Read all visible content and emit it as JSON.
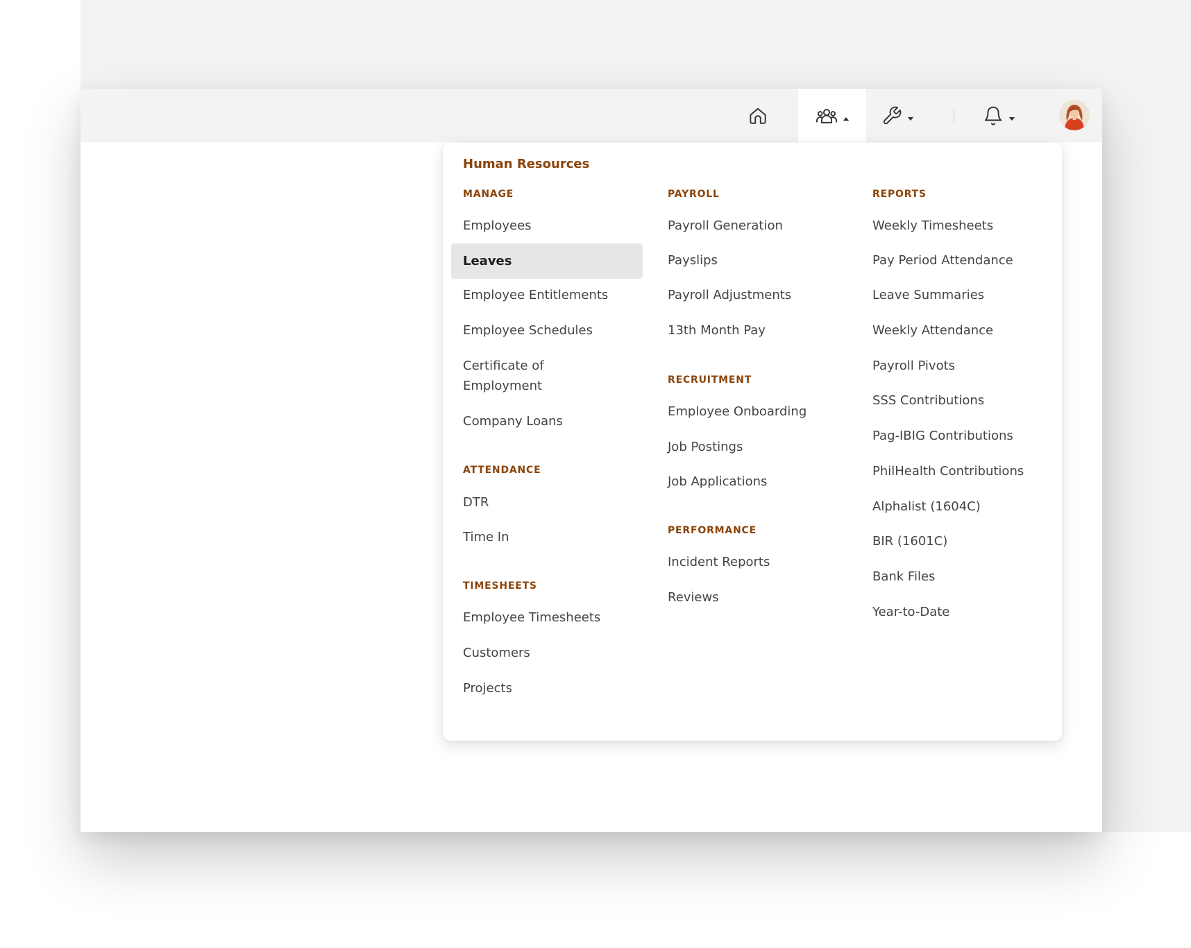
{
  "nav": {
    "icons": [
      "home-icon",
      "people-icon",
      "wrench-icon",
      "bell-icon"
    ],
    "avatar_icon": "user-avatar"
  },
  "menu": {
    "title": "Human Resources",
    "selected": "Leaves",
    "columns": [
      {
        "sections": [
          {
            "heading": "MANAGE",
            "items": [
              "Employees",
              "Leaves",
              "Employee Entitlements",
              "Employee Schedules",
              "Certificate of Employment",
              "Company Loans"
            ]
          },
          {
            "heading": "ATTENDANCE",
            "items": [
              "DTR",
              "Time In"
            ]
          },
          {
            "heading": "TIMESHEETS",
            "items": [
              "Employee Timesheets",
              "Customers",
              "Projects"
            ]
          }
        ]
      },
      {
        "sections": [
          {
            "heading": "PAYROLL",
            "items": [
              "Payroll Generation",
              "Payslips",
              "Payroll Adjustments",
              "13th Month Pay"
            ]
          },
          {
            "heading": "RECRUITMENT",
            "items": [
              "Employee Onboarding",
              "Job Postings",
              "Job Applications"
            ]
          },
          {
            "heading": "PERFORMANCE",
            "items": [
              "Incident Reports",
              "Reviews"
            ]
          }
        ]
      },
      {
        "sections": [
          {
            "heading": "REPORTS",
            "items": [
              "Weekly Timesheets",
              "Pay Period Attendance",
              "Leave Summaries",
              "Weekly Attendance",
              "Payroll Pivots",
              "SSS Contributions",
              "Pag-IBIG Contributions",
              "PhilHealth Contributions",
              "Alphalist (1604C)",
              "BIR (1601C)",
              "Bank Files",
              "Year-to-Date"
            ]
          }
        ]
      }
    ]
  },
  "colors": {
    "accent": "#8a4409",
    "selected_bg": "#e6e6e6",
    "topbar_bg": "#f3f3f3"
  }
}
